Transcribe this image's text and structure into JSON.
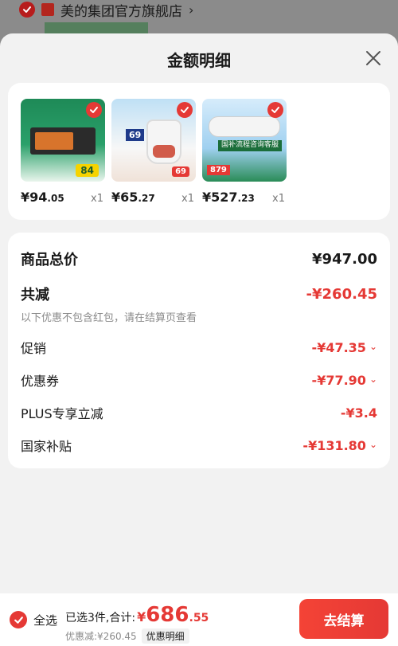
{
  "store": {
    "name": "美的集团官方旗舰店",
    "chevron": "›"
  },
  "sheet": {
    "title": "金额明细"
  },
  "products": [
    {
      "price_int": "¥94",
      "price_dec": ".05",
      "qty": "x1",
      "badge": "84"
    },
    {
      "price_int": "¥65",
      "price_dec": ".27",
      "qty": "x1",
      "badge": "69",
      "badge2": "69"
    },
    {
      "price_int": "¥527",
      "price_dec": ".23",
      "qty": "x1",
      "badge": "879",
      "side_label": "国补流程咨询客服"
    }
  ],
  "summary": {
    "total_label": "商品总价",
    "total_value": "¥947.00",
    "reduce_label": "共减",
    "reduce_value": "-¥260.45",
    "note": "以下优惠不包含红包，请在结算页查看",
    "promo_label": "促销",
    "promo_value": "-¥47.35",
    "coupon_label": "优惠券",
    "coupon_value": "-¥77.90",
    "plus_label": "PLUS专享立减",
    "plus_value": "-¥3.4",
    "subsidy_label": "国家补贴",
    "subsidy_value": "-¥131.80"
  },
  "bottom": {
    "select_all": "全选",
    "selected_text": "已选3件,合计:",
    "yen": "¥",
    "total_int": "686",
    "total_dec": ".55",
    "discount_text": "优惠减:¥260.45",
    "detail_pill": "优惠明细",
    "checkout": "去结算"
  },
  "colors": {
    "accent": "#e53935"
  }
}
